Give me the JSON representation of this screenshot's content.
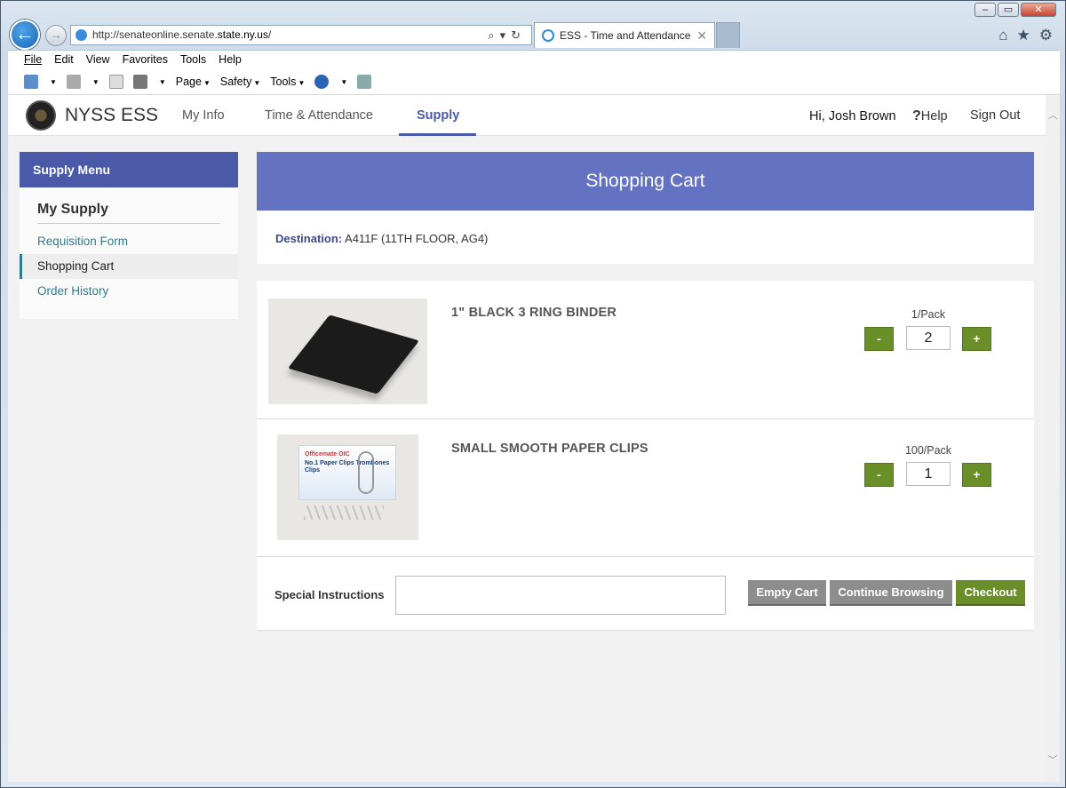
{
  "browser": {
    "url_prefix": "http://senateonline.senate.",
    "url_bold": "state.ny.us",
    "url_suffix": "/",
    "tab_title": "ESS - Time and Attendance",
    "menu": [
      "File",
      "Edit",
      "View",
      "Favorites",
      "Tools",
      "Help"
    ],
    "commands": [
      "Page",
      "Safety",
      "Tools"
    ]
  },
  "app": {
    "brand": "NYSS ESS",
    "nav": [
      "My Info",
      "Time & Attendance",
      "Supply"
    ],
    "active_nav": "Supply",
    "greeting": "Hi, Josh Brown",
    "help": "Help",
    "sign_out": "Sign Out"
  },
  "sidebar": {
    "title": "Supply Menu",
    "section": "My Supply",
    "links": [
      "Requisition Form",
      "Shopping Cart",
      "Order History"
    ],
    "active_link": "Shopping Cart"
  },
  "cart": {
    "title": "Shopping Cart",
    "destination_label": "Destination:",
    "destination_value": "A411F (11TH FLOOR, AG4)",
    "items": [
      {
        "name": "1\" BLACK 3 RING BINDER",
        "pack": "1/Pack",
        "quantity": "2"
      },
      {
        "name": "SMALL SMOOTH PAPER CLIPS",
        "pack": "100/Pack",
        "quantity": "1"
      }
    ],
    "minus_label": "-",
    "plus_label": "+",
    "special_instructions_label": "Special Instructions",
    "special_instructions_value": "",
    "buttons": {
      "empty": "Empty Cart",
      "continue": "Continue Browsing",
      "checkout": "Checkout"
    },
    "clip_box_text": {
      "brand": "Officemate OIC",
      "product": "No.1 Paper Clips Trombones Clips"
    }
  },
  "colors": {
    "accent": "#4b5aa8",
    "header_band": "#6472c2",
    "action_green": "#6b8f28",
    "neutral_button": "#8d8d8d",
    "link": "#2f7c8f"
  }
}
